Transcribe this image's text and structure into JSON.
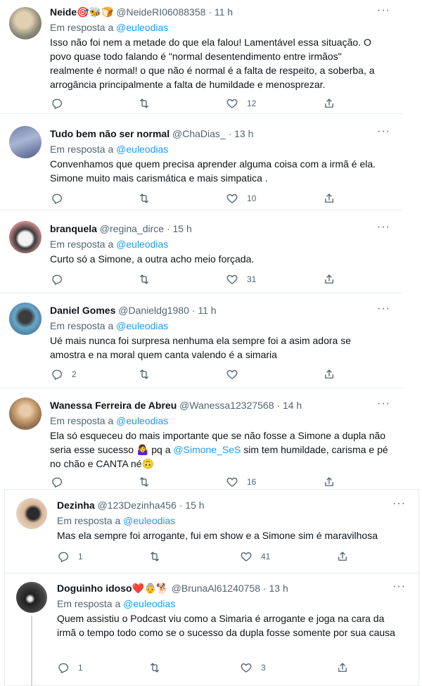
{
  "tweets": [
    {
      "name": "Neide",
      "emoji": "🎯🐝🍞",
      "handle": "@NeideRI06088358",
      "time": "11 h",
      "reply_prefix": "Em resposta a",
      "reply_to": "@euleodias",
      "text": "Isso não foi nem a metade do que ela falou! Lamentável essa situação. O povo quase todo falando é \"normal desentendimento entre irmãos\" realmente é normal!  o que não é normal é a falta de respeito, a soberba, a arrogância principalmente a falta de humildade e menosprezar.",
      "replies": "",
      "likes": "12"
    },
    {
      "name": "Tudo bem não ser normal",
      "emoji": "",
      "handle": "@ChaDias_",
      "time": "13 h",
      "reply_prefix": "Em resposta a",
      "reply_to": "@euleodias",
      "text": "Convenhamos que quem precisa aprender alguma coisa com a irmã é ela. Simone muito mais carismática e mais simpatica .",
      "replies": "",
      "likes": "10"
    },
    {
      "name": "branquela",
      "emoji": "",
      "handle": "@regina_dirce",
      "time": "15 h",
      "reply_prefix": "Em resposta a",
      "reply_to": "@euleodias",
      "text": "Curto só a Simone, a outra acho meio forçada.",
      "replies": "",
      "likes": "31"
    },
    {
      "name": "Daniel Gomes",
      "emoji": "",
      "handle": "@Danieldg1980",
      "time": "11 h",
      "reply_prefix": "Em resposta a",
      "reply_to": "@euleodias",
      "text": "Ué mais nunca foi surpresa nenhuma ela sempre foi a asim adora se amostra e na moral quem canta valendo é a simaria",
      "replies": "2",
      "likes": ""
    },
    {
      "name": "Wanessa Ferreira de Abreu",
      "emoji": "",
      "handle": "@Wanessa12327568",
      "time": "14 h",
      "reply_prefix": "Em resposta a",
      "reply_to": "@euleodias",
      "text_a": "Ela só esqueceu do mais importante que se não fosse a Simone a dupla não seria esse sucesso 🤷‍♀️ pq a ",
      "mention": "@Simone_SeS",
      "text_b": " sim tem humildade, carisma e pé no chão e CANTA né🙃",
      "replies": "",
      "likes": "16"
    },
    {
      "name": "Dezinha",
      "emoji": "",
      "handle": "@123Dezinha456",
      "time": "15 h",
      "reply_prefix": "Em resposta a",
      "reply_to": "@euleodias",
      "text": "Mas ela sempre foi arrogante, fui em show e a Simone sim é maravilhosa",
      "replies": "1",
      "likes": "41"
    },
    {
      "name": "Doguinho idoso",
      "emoji": "❤️👵🐕",
      "handle": "@BrunaAl61240758",
      "time": "13 h",
      "reply_prefix": "Em resposta a",
      "reply_to": "@euleodias",
      "text": "Quem assistiu o Podcast viu como a Simaria é arrogante e joga na cara da irmã o tempo todo como se o sucesso da dupla fosse somente por sua causa",
      "replies": "1",
      "likes": "3"
    }
  ],
  "icons": {
    "reply": "reply-icon",
    "retweet": "retweet-icon",
    "like": "heart-icon",
    "share": "share-icon",
    "more": "more-icon"
  },
  "colors": {
    "link": "#1d9bf0",
    "muted": "#536471",
    "text": "#0f1419"
  }
}
